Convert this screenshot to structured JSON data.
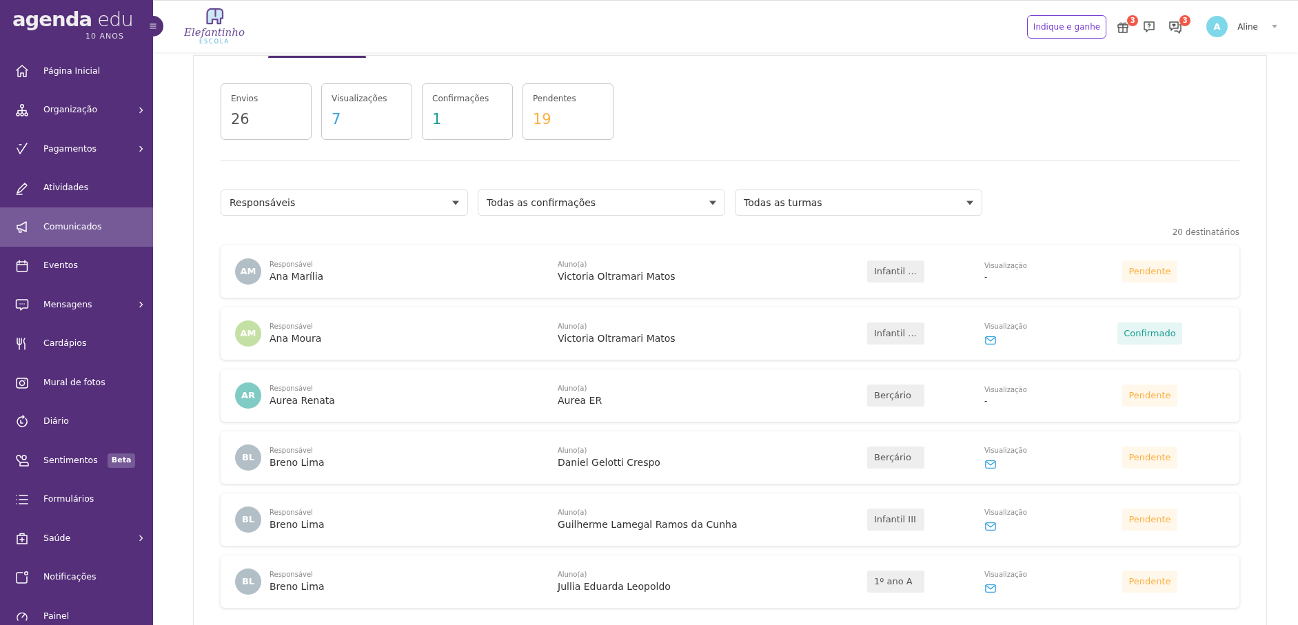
{
  "sidebar": {
    "brand": "**agenda** edu",
    "brand_sub": "10 ANOS",
    "items": [
      {
        "label": "Página Inicial",
        "selected": false,
        "expandable": false
      },
      {
        "label": "Organização",
        "selected": false,
        "expandable": true
      },
      {
        "label": "Pagamentos",
        "selected": false,
        "expandable": true
      },
      {
        "label": "Atividades",
        "selected": false,
        "expandable": false
      },
      {
        "label": "Comunicados",
        "selected": true,
        "expandable": false
      },
      {
        "label": "Eventos",
        "selected": false,
        "expandable": false
      },
      {
        "label": "Mensagens",
        "selected": false,
        "expandable": true
      },
      {
        "label": "Cardápios",
        "selected": false,
        "expandable": false
      },
      {
        "label": "Mural de fotos",
        "selected": false,
        "expandable": false
      },
      {
        "label": "Diário",
        "selected": false,
        "expandable": false
      },
      {
        "label": "Sentimentos",
        "selected": false,
        "expandable": false,
        "badge": "Beta"
      },
      {
        "label": "Formulários",
        "selected": false,
        "expandable": false
      },
      {
        "label": "Saúde",
        "selected": false,
        "expandable": true
      },
      {
        "label": "Notificações",
        "selected": false,
        "expandable": false
      },
      {
        "label": "Painel",
        "selected": false,
        "expandable": false
      }
    ]
  },
  "header": {
    "school": "Elefantinho",
    "school_sub": "ESCOLA",
    "refer_button": "Indique e ganhe",
    "gift_count": "3",
    "chat_count": "3",
    "user_initial": "A",
    "user_name": "Aline"
  },
  "stats": [
    {
      "label": "Envios",
      "value": "26",
      "color": "#555555"
    },
    {
      "label": "Visualizações",
      "value": "7",
      "color": "#3ba3dc"
    },
    {
      "label": "Confirmações",
      "value": "1",
      "color": "#1a9e91"
    },
    {
      "label": "Pendentes",
      "value": "19",
      "color": "#fbb040"
    }
  ],
  "filters": [
    {
      "value": "Responsáveis"
    },
    {
      "value": "Todas as confirmações"
    },
    {
      "value": "Todas as turmas"
    }
  ],
  "recipient_count": "20 destinatários",
  "rows": [
    {
      "initials": "AM",
      "color": "#b3bfc6",
      "responsible_label": "Responsável",
      "responsible": "Ana Marília",
      "student_label": "Aluno(a)",
      "student": "Victoria Oltramari Matos",
      "class": "Infantil ...",
      "view_label": "Visualização",
      "viewed": false,
      "view_value": "-",
      "status": {
        "kind": "pending",
        "text": "Pendente"
      }
    },
    {
      "initials": "AM",
      "color": "#c5e0a5",
      "responsible_label": "Responsável",
      "responsible": "Ana Moura",
      "student_label": "Aluno(a)",
      "student": "Victoria Oltramari Matos",
      "class": "Infantil ...",
      "view_label": "Visualização",
      "viewed": true,
      "status": {
        "kind": "confirmed",
        "text": "Confirmado"
      }
    },
    {
      "initials": "AR",
      "color": "#80cbc4",
      "responsible_label": "Responsável",
      "responsible": "Aurea Renata",
      "student_label": "Aluno(a)",
      "student": "Aurea ER",
      "class": "Berçário",
      "view_label": "Visualização",
      "viewed": false,
      "view_value": "-",
      "status": {
        "kind": "pending",
        "text": "Pendente"
      }
    },
    {
      "initials": "BL",
      "color": "#b3bfc6",
      "responsible_label": "Responsável",
      "responsible": "Breno Lima",
      "student_label": "Aluno(a)",
      "student": "Daniel Gelotti Crespo",
      "class": "Berçário",
      "view_label": "Visualização",
      "viewed": true,
      "status": {
        "kind": "pending",
        "text": "Pendente"
      }
    },
    {
      "initials": "BL",
      "color": "#b3bfc6",
      "responsible_label": "Responsável",
      "responsible": "Breno Lima",
      "student_label": "Aluno(a)",
      "student": "Guilherme Lamegal Ramos da Cunha",
      "class": "Infantil III",
      "view_label": "Visualização",
      "viewed": true,
      "status": {
        "kind": "pending",
        "text": "Pendente"
      }
    },
    {
      "initials": "BL",
      "color": "#b3bfc6",
      "responsible_label": "Responsável",
      "responsible": "Breno Lima",
      "student_label": "Aluno(a)",
      "student": "Jullia Eduarda Leopoldo",
      "class": "1º ano A",
      "view_label": "Visualização",
      "viewed": true,
      "status": {
        "kind": "pending",
        "text": "Pendente"
      }
    }
  ]
}
